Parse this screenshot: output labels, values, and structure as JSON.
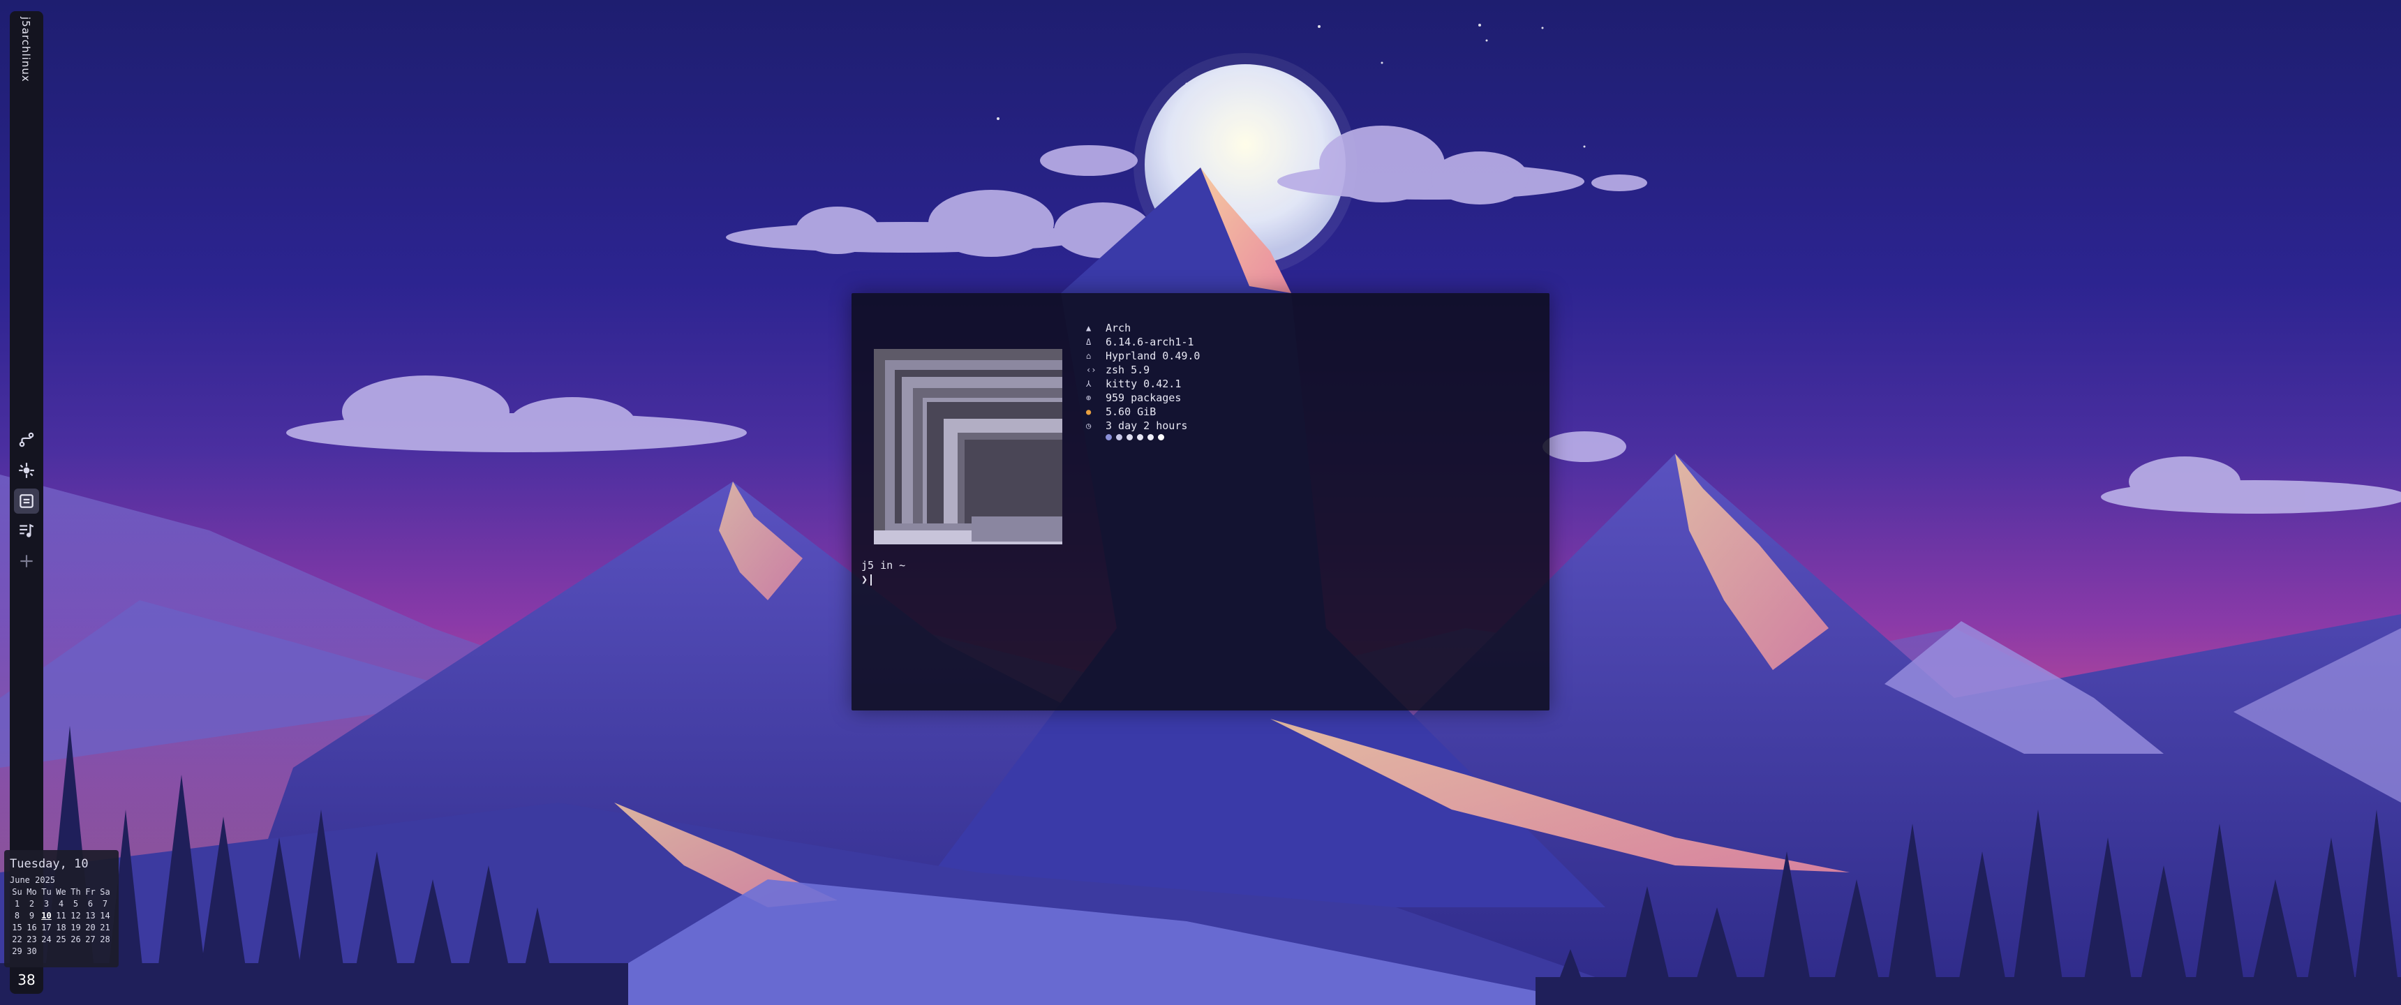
{
  "bar": {
    "title": "j5archlinux",
    "workspaces": [
      {
        "icon": "git-branch-icon",
        "active": false
      },
      {
        "icon": "gear-icon",
        "active": false
      },
      {
        "icon": "terminal-window-icon",
        "active": true
      },
      {
        "icon": "music-playlist-icon",
        "active": false
      },
      {
        "icon": "plus-icon",
        "active": false
      }
    ],
    "counter": "38"
  },
  "calendar": {
    "date_label": "Tuesday, 10",
    "month_label": "June 2025",
    "weekdays": [
      "Su",
      "Mo",
      "Tu",
      "We",
      "Th",
      "Fr",
      "Sa"
    ],
    "days": [
      "1",
      "2",
      "3",
      "4",
      "5",
      "6",
      "7",
      "8",
      "9",
      "10",
      "11",
      "12",
      "13",
      "14",
      "15",
      "16",
      "17",
      "18",
      "19",
      "20",
      "21",
      "22",
      "23",
      "24",
      "25",
      "26",
      "27",
      "28",
      "29",
      "30"
    ],
    "today": "10"
  },
  "terminal": {
    "fetch": [
      {
        "icon": "arch-icon",
        "glyph": "▲",
        "text": "Arch"
      },
      {
        "icon": "kernel-icon",
        "glyph": "Δ",
        "text": "6.14.6-arch1-1"
      },
      {
        "icon": "wm-icon",
        "glyph": "⌂",
        "text": "Hyprland 0.49.0"
      },
      {
        "icon": "shell-icon",
        "glyph": "‹›",
        "text": "zsh 5.9"
      },
      {
        "icon": "terminal-icon",
        "glyph": "⅄",
        "text": "kitty 0.42.1"
      },
      {
        "icon": "package-icon",
        "glyph": "⊕",
        "text": "959 packages"
      },
      {
        "icon": "memory-icon",
        "glyph": "●",
        "text": "5.60 GiB"
      },
      {
        "icon": "uptime-icon",
        "glyph": "◷",
        "text": "3 day 2 hours"
      }
    ],
    "palette": [
      "#8a8fd8",
      "#c8c8e8",
      "#dedef0",
      "#e6e6f4",
      "#f0f0fa",
      "#ffffff"
    ],
    "prompt_line": "j5 in ~",
    "prompt_symbol": "❯"
  },
  "colors": {
    "sky_top": "#1e1e70",
    "horizon_pink": "#f06a7a",
    "bar_bg": "#141420",
    "memory_icon": "#e8a040"
  }
}
